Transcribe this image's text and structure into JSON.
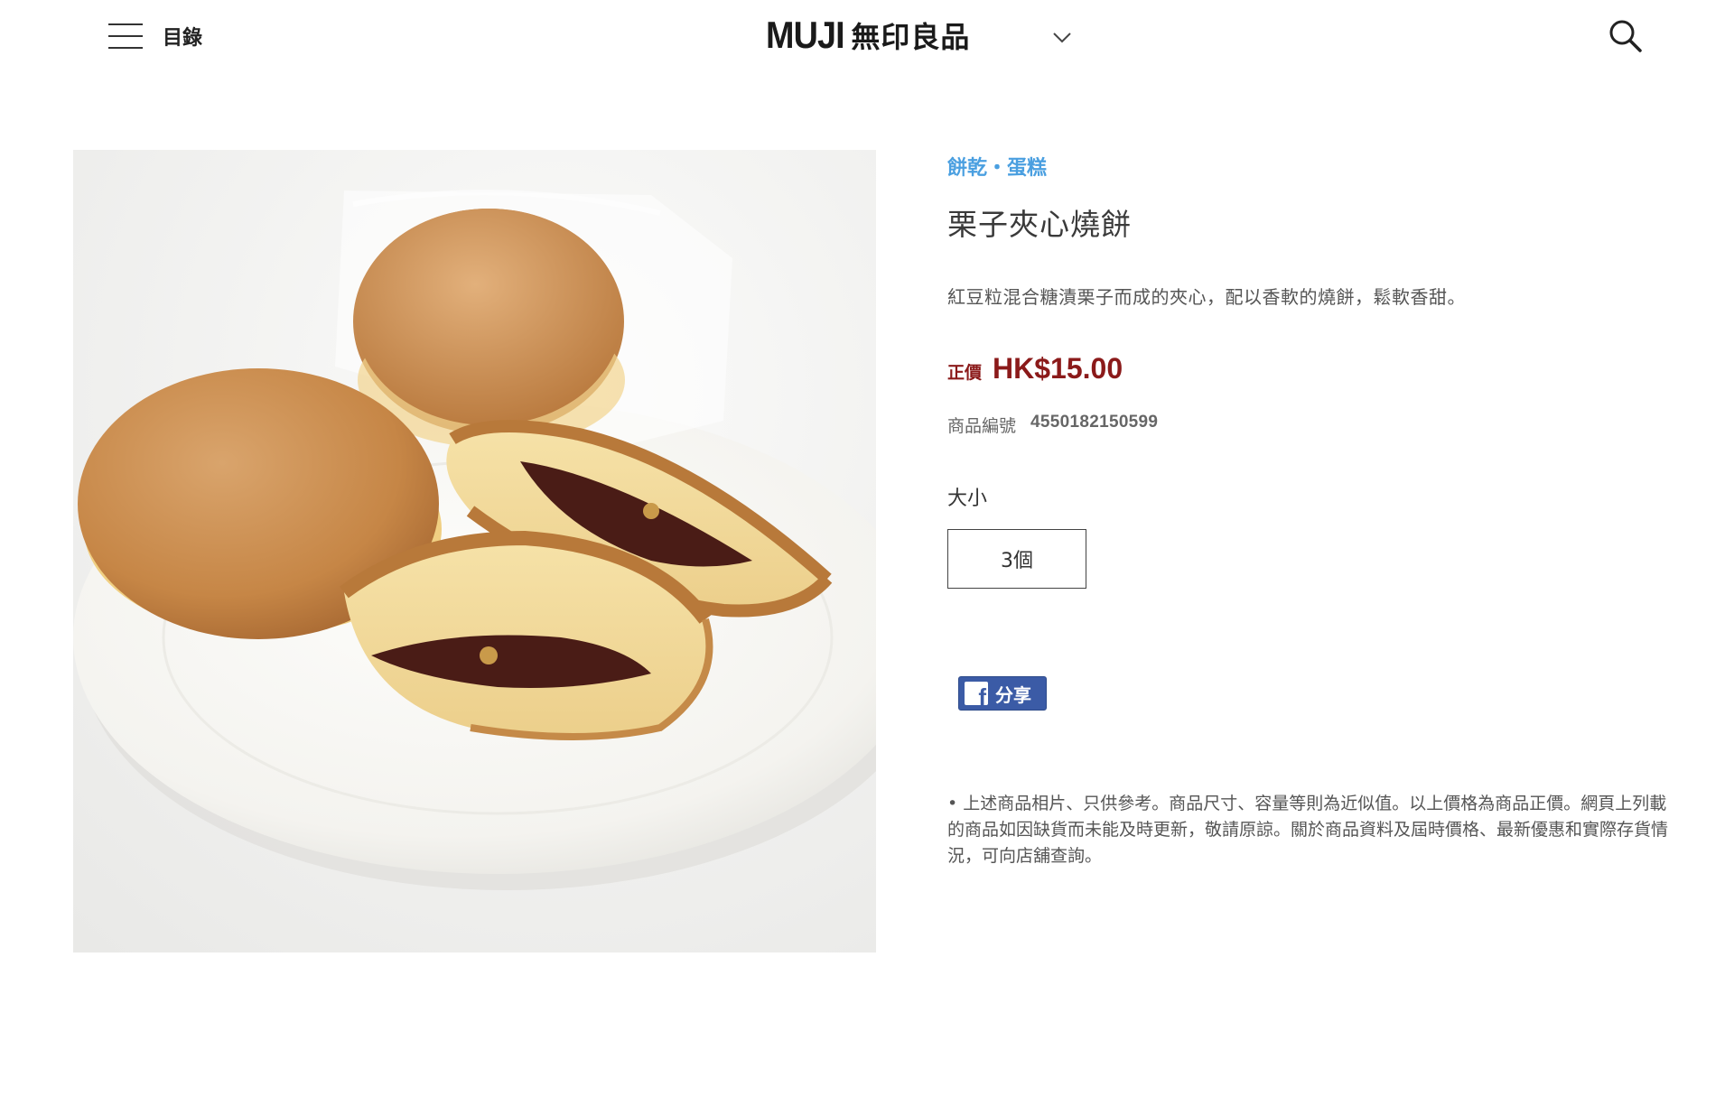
{
  "header": {
    "menu_label": "目錄",
    "logo_en": "MUJI",
    "logo_zh": "無印良品"
  },
  "product": {
    "category": "餅乾・蛋糕",
    "title": "栗子夾心燒餅",
    "description": "紅豆粒混合糖漬栗子而成的夾心，配以香軟的燒餅，鬆軟香甜。",
    "price_label": "正價",
    "price": "HK$15.00",
    "sku_label": "商品編號",
    "sku": "4550182150599",
    "size_label": "大小",
    "size_option": "3個"
  },
  "share": {
    "facebook_label": "分享"
  },
  "disclaimer": "• 上述商品相片、只供參考。商品尺寸、容量等則為近似值。以上價格為商品正價。網頁上列載的商品如因缺貨而未能及時更新，敬請原諒。關於商品資料及屆時價格、最新優惠和實際存貨情況，可向店舖查詢。",
  "colors": {
    "category": "#4a9fe0",
    "price": "#8b1a1a",
    "facebook": "#3b5ba6"
  },
  "icons": {
    "menu": "hamburger-icon",
    "region": "chevron-down-icon",
    "search": "search-icon",
    "facebook": "facebook-icon"
  }
}
